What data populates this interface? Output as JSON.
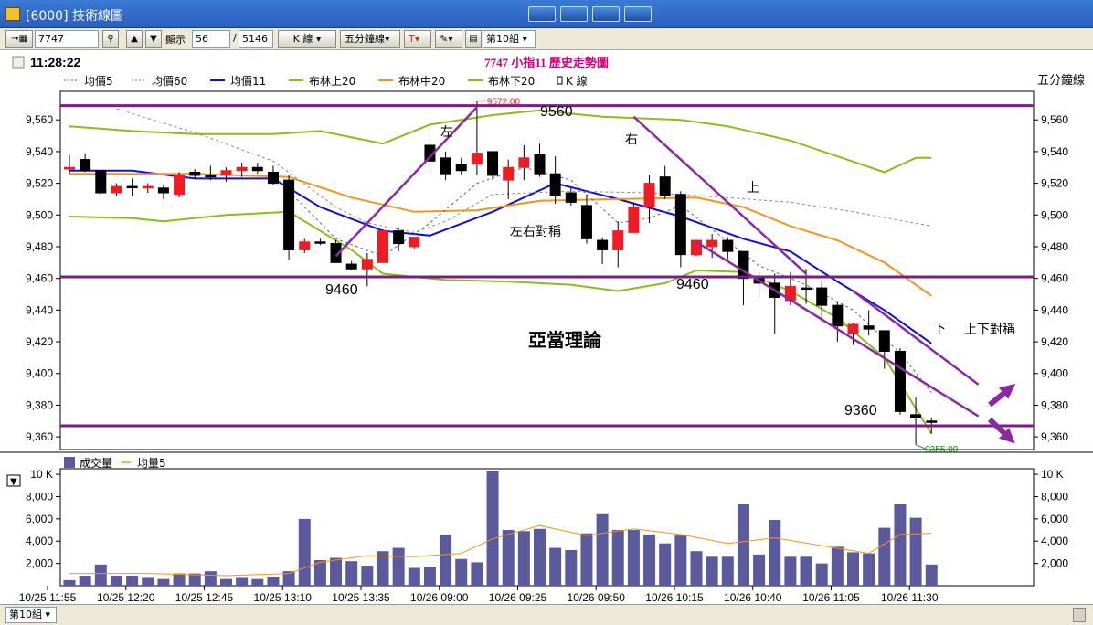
{
  "window": {
    "title": "[6000] 技術線圖"
  },
  "toolbar": {
    "symbol": "7747",
    "display_label": "顯示",
    "display_count": "56",
    "total_count": "5146",
    "chart_type": "K 線",
    "period": "五分鐘線",
    "text_tool": "T",
    "group": "第10組"
  },
  "header": {
    "time": "11:28:22",
    "chart_title": "7747 小指11  歷史走勢圖",
    "period_label": "五分鐘線"
  },
  "legend": [
    {
      "label": "均價5",
      "color": "#555555",
      "style": "dash"
    },
    {
      "label": "均價60",
      "color": "#777777",
      "style": "dash"
    },
    {
      "label": "均價11",
      "color": "#1010d0",
      "style": "solid"
    },
    {
      "label": "布林上20",
      "color": "#8cbc1c",
      "style": "solid"
    },
    {
      "label": "布林中20",
      "color": "#f0961e",
      "style": "solid"
    },
    {
      "label": "布林下20",
      "color": "#8cbc1c",
      "style": "solid"
    },
    {
      "label": "K 線",
      "color": "#000000",
      "style": "candle-icon"
    }
  ],
  "volume_legend": [
    {
      "label": "成交量",
      "color": "#5a5a9c"
    },
    {
      "label": "均量5",
      "color": "#f0961e"
    }
  ],
  "colors": {
    "up": "#ee1c24",
    "down": "#000000",
    "volume": "#5a5a9c",
    "level_line": "#7a1e84",
    "trend_line": "#8a2aa0",
    "annotation_text": "#c0007a"
  },
  "chart_data": {
    "type": "candlestick",
    "title": "7747 小指11  歷史走勢圖",
    "price_axis": {
      "ticks": [
        "9,360",
        "9,380",
        "9,400",
        "9,420",
        "9,440",
        "9,460",
        "9,480",
        "9,500",
        "9,520",
        "9,540",
        "9,560"
      ],
      "range": [
        9352,
        9578
      ]
    },
    "volume_axis": {
      "ticks": [
        "2,000",
        "4,000",
        "6,000",
        "8,000",
        "10 K"
      ],
      "range": [
        0,
        10500
      ]
    },
    "time_labels": [
      "10/25 11:55",
      "10/25 12:20",
      "10/25 12:45",
      "10/25 13:10",
      "10/25 13:35",
      "10/26 09:00",
      "10/26 09:25",
      "10/26 09:50",
      "10/26 10:15",
      "10/26 10:40",
      "10/26 11:05",
      "10/26 11:30"
    ],
    "candles": [
      {
        "o": 9529,
        "h": 9538,
        "l": 9526,
        "c": 9530
      },
      {
        "o": 9535,
        "h": 9539,
        "l": 9527,
        "c": 9528
      },
      {
        "o": 9528,
        "h": 9528,
        "l": 9513,
        "c": 9514
      },
      {
        "o": 9514,
        "h": 9520,
        "l": 9512,
        "c": 9518
      },
      {
        "o": 9518,
        "h": 9523,
        "l": 9512,
        "c": 9518
      },
      {
        "o": 9517,
        "h": 9520,
        "l": 9514,
        "c": 9518
      },
      {
        "o": 9517,
        "h": 9519,
        "l": 9510,
        "c": 9514
      },
      {
        "o": 9513,
        "h": 9527,
        "l": 9511,
        "c": 9525
      },
      {
        "o": 9527,
        "h": 9529,
        "l": 9523,
        "c": 9525
      },
      {
        "o": 9525,
        "h": 9531,
        "l": 9522,
        "c": 9524
      },
      {
        "o": 9525,
        "h": 9530,
        "l": 9521,
        "c": 9528
      },
      {
        "o": 9528,
        "h": 9533,
        "l": 9524,
        "c": 9530
      },
      {
        "o": 9530,
        "h": 9533,
        "l": 9526,
        "c": 9528
      },
      {
        "o": 9527,
        "h": 9531,
        "l": 9519,
        "c": 9520
      },
      {
        "o": 9522,
        "h": 9525,
        "l": 9472,
        "c": 9478
      },
      {
        "o": 9478,
        "h": 9485,
        "l": 9476,
        "c": 9483
      },
      {
        "o": 9483,
        "h": 9485,
        "l": 9481,
        "c": 9483
      },
      {
        "o": 9482,
        "h": 9484,
        "l": 9470,
        "c": 9470
      },
      {
        "o": 9469,
        "h": 9471,
        "l": 9465,
        "c": 9466
      },
      {
        "o": 9466,
        "h": 9476,
        "l": 9455,
        "c": 9472
      },
      {
        "o": 9470,
        "h": 9491,
        "l": 9470,
        "c": 9490
      },
      {
        "o": 9490,
        "h": 9492,
        "l": 9477,
        "c": 9482
      },
      {
        "o": 9480,
        "h": 9486,
        "l": 9479,
        "c": 9486
      },
      {
        "o": 9544,
        "h": 9553,
        "l": 9527,
        "c": 9534
      },
      {
        "o": 9536,
        "h": 9540,
        "l": 9522,
        "c": 9526
      },
      {
        "o": 9532,
        "h": 9536,
        "l": 9525,
        "c": 9528
      },
      {
        "o": 9532,
        "h": 9572,
        "l": 9525,
        "c": 9539
      },
      {
        "o": 9540,
        "h": 9540,
        "l": 9522,
        "c": 9525
      },
      {
        "o": 9522,
        "h": 9535,
        "l": 9510,
        "c": 9530
      },
      {
        "o": 9530,
        "h": 9544,
        "l": 9522,
        "c": 9536
      },
      {
        "o": 9538,
        "h": 9545,
        "l": 9524,
        "c": 9526
      },
      {
        "o": 9526,
        "h": 9537,
        "l": 9507,
        "c": 9512
      },
      {
        "o": 9514,
        "h": 9517,
        "l": 9506,
        "c": 9508
      },
      {
        "o": 9506,
        "h": 9513,
        "l": 9482,
        "c": 9485
      },
      {
        "o": 9484,
        "h": 9486,
        "l": 9469,
        "c": 9478
      },
      {
        "o": 9478,
        "h": 9496,
        "l": 9467,
        "c": 9490
      },
      {
        "o": 9489,
        "h": 9508,
        "l": 9489,
        "c": 9505
      },
      {
        "o": 9505,
        "h": 9525,
        "l": 9495,
        "c": 9520
      },
      {
        "o": 9524,
        "h": 9531,
        "l": 9510,
        "c": 9512
      },
      {
        "o": 9513,
        "h": 9515,
        "l": 9467,
        "c": 9475
      },
      {
        "o": 9475,
        "h": 9484,
        "l": 9474,
        "c": 9484
      },
      {
        "o": 9480,
        "h": 9488,
        "l": 9473,
        "c": 9484
      },
      {
        "o": 9484,
        "h": 9486,
        "l": 9472,
        "c": 9477
      },
      {
        "o": 9477,
        "h": 9477,
        "l": 9443,
        "c": 9460
      },
      {
        "o": 9460,
        "h": 9464,
        "l": 9448,
        "c": 9457
      },
      {
        "o": 9457,
        "h": 9463,
        "l": 9425,
        "c": 9448
      },
      {
        "o": 9446,
        "h": 9464,
        "l": 9443,
        "c": 9455
      },
      {
        "o": 9454,
        "h": 9466,
        "l": 9444,
        "c": 9454
      },
      {
        "o": 9454,
        "h": 9458,
        "l": 9433,
        "c": 9443
      },
      {
        "o": 9443,
        "h": 9445,
        "l": 9420,
        "c": 9430
      },
      {
        "o": 9425,
        "h": 9432,
        "l": 9418,
        "c": 9431
      },
      {
        "o": 9430,
        "h": 9440,
        "l": 9424,
        "c": 9428
      },
      {
        "o": 9427,
        "h": 9427,
        "l": 9403,
        "c": 9414
      },
      {
        "o": 9414,
        "h": 9416,
        "l": 9374,
        "c": 9376
      },
      {
        "o": 9374,
        "h": 9385,
        "l": 9355,
        "c": 9372
      },
      {
        "o": 9370,
        "h": 9372,
        "l": 9362,
        "c": 9370
      }
    ],
    "volumes": [
      500,
      900,
      1900,
      900,
      900,
      700,
      600,
      1100,
      1100,
      1300,
      600,
      700,
      600,
      800,
      1300,
      6000,
      2300,
      2500,
      2200,
      1800,
      3100,
      3400,
      1600,
      1700,
      4600,
      2400,
      2100,
      10300,
      5000,
      4900,
      5100,
      3400,
      3200,
      4700,
      6500,
      5000,
      5000,
      4600,
      3800,
      4500,
      3100,
      2600,
      2600,
      7300,
      2800,
      5900,
      2600,
      2600,
      2000,
      3500,
      3000,
      2900,
      5200,
      7300,
      6100,
      1900
    ],
    "series": [
      {
        "name": "均價11",
        "color": "#1010d0",
        "values": [
          {
            "i": 0,
            "v": 9528
          },
          {
            "i": 4,
            "v": 9528
          },
          {
            "i": 8,
            "v": 9523
          },
          {
            "i": 13,
            "v": 9523
          },
          {
            "i": 16,
            "v": 9505
          },
          {
            "i": 20,
            "v": 9490
          },
          {
            "i": 23,
            "v": 9487
          },
          {
            "i": 27,
            "v": 9502
          },
          {
            "i": 31,
            "v": 9520
          },
          {
            "i": 35,
            "v": 9510
          },
          {
            "i": 39,
            "v": 9499
          },
          {
            "i": 43,
            "v": 9485
          },
          {
            "i": 46,
            "v": 9477
          },
          {
            "i": 49,
            "v": 9458
          },
          {
            "i": 52,
            "v": 9440
          },
          {
            "i": 55,
            "v": 9419
          }
        ]
      },
      {
        "name": "布林上20",
        "color": "#8cbc1c",
        "values": [
          {
            "i": 0,
            "v": 9556
          },
          {
            "i": 4,
            "v": 9553
          },
          {
            "i": 8,
            "v": 9551
          },
          {
            "i": 13,
            "v": 9551
          },
          {
            "i": 16,
            "v": 9553
          },
          {
            "i": 20,
            "v": 9545
          },
          {
            "i": 23,
            "v": 9557
          },
          {
            "i": 27,
            "v": 9563
          },
          {
            "i": 30,
            "v": 9566
          },
          {
            "i": 34,
            "v": 9562
          },
          {
            "i": 39,
            "v": 9560
          },
          {
            "i": 42,
            "v": 9556
          },
          {
            "i": 46,
            "v": 9547
          },
          {
            "i": 49,
            "v": 9537
          },
          {
            "i": 52,
            "v": 9527
          },
          {
            "i": 54,
            "v": 9536
          },
          {
            "i": 55,
            "v": 9536
          }
        ]
      },
      {
        "name": "布林中20",
        "color": "#f0961e",
        "values": [
          {
            "i": 0,
            "v": 9526
          },
          {
            "i": 8,
            "v": 9526
          },
          {
            "i": 14,
            "v": 9524
          },
          {
            "i": 18,
            "v": 9511
          },
          {
            "i": 22,
            "v": 9502
          },
          {
            "i": 26,
            "v": 9503
          },
          {
            "i": 30,
            "v": 9509
          },
          {
            "i": 35,
            "v": 9510
          },
          {
            "i": 40,
            "v": 9511
          },
          {
            "i": 43,
            "v": 9505
          },
          {
            "i": 46,
            "v": 9493
          },
          {
            "i": 49,
            "v": 9484
          },
          {
            "i": 52,
            "v": 9470
          },
          {
            "i": 55,
            "v": 9449
          }
        ]
      },
      {
        "name": "布林下20",
        "color": "#8cbc1c",
        "values": [
          {
            "i": 0,
            "v": 9499
          },
          {
            "i": 4,
            "v": 9498
          },
          {
            "i": 6,
            "v": 9496
          },
          {
            "i": 10,
            "v": 9500
          },
          {
            "i": 14,
            "v": 9502
          },
          {
            "i": 18,
            "v": 9478
          },
          {
            "i": 20,
            "v": 9463
          },
          {
            "i": 24,
            "v": 9459
          },
          {
            "i": 28,
            "v": 9458
          },
          {
            "i": 32,
            "v": 9456
          },
          {
            "i": 35,
            "v": 9452
          },
          {
            "i": 38,
            "v": 9457
          },
          {
            "i": 40,
            "v": 9465
          },
          {
            "i": 43,
            "v": 9464
          },
          {
            "i": 46,
            "v": 9452
          },
          {
            "i": 49,
            "v": 9435
          },
          {
            "i": 52,
            "v": 9410
          },
          {
            "i": 55,
            "v": 9362
          }
        ]
      },
      {
        "name": "均價60",
        "color": "#888888",
        "values": [
          {
            "i": 3,
            "v": 9567
          },
          {
            "i": 8,
            "v": 9552
          },
          {
            "i": 13,
            "v": 9534
          },
          {
            "i": 17,
            "v": 9505
          },
          {
            "i": 19,
            "v": 9495
          },
          {
            "i": 22,
            "v": 9489
          },
          {
            "i": 24,
            "v": 9496
          },
          {
            "i": 27,
            "v": 9513
          },
          {
            "i": 32,
            "v": 9515
          },
          {
            "i": 37,
            "v": 9514
          },
          {
            "i": 42,
            "v": 9511
          },
          {
            "i": 46,
            "v": 9508
          },
          {
            "i": 50,
            "v": 9502
          },
          {
            "i": 55,
            "v": 9493
          }
        ]
      },
      {
        "name": "均價5",
        "color": "#666666",
        "values": [
          {
            "i": 14,
            "v": 9515
          },
          {
            "i": 17,
            "v": 9485
          },
          {
            "i": 20,
            "v": 9474
          },
          {
            "i": 23,
            "v": 9495
          },
          {
            "i": 26,
            "v": 9520
          },
          {
            "i": 29,
            "v": 9530
          },
          {
            "i": 32,
            "v": 9522
          },
          {
            "i": 35,
            "v": 9495
          },
          {
            "i": 37,
            "v": 9498
          },
          {
            "i": 39,
            "v": 9506
          },
          {
            "i": 41,
            "v": 9491
          },
          {
            "i": 44,
            "v": 9468
          },
          {
            "i": 47,
            "v": 9456
          },
          {
            "i": 50,
            "v": 9440
          },
          {
            "i": 53,
            "v": 9413
          },
          {
            "i": 55,
            "v": 9388
          }
        ]
      }
    ],
    "volume_ma": [
      {
        "i": 0,
        "v": 1100
      },
      {
        "i": 5,
        "v": 1100
      },
      {
        "i": 10,
        "v": 900
      },
      {
        "i": 14,
        "v": 1100
      },
      {
        "i": 16,
        "v": 2100
      },
      {
        "i": 19,
        "v": 2700
      },
      {
        "i": 22,
        "v": 2600
      },
      {
        "i": 25,
        "v": 2900
      },
      {
        "i": 27,
        "v": 4200
      },
      {
        "i": 30,
        "v": 5400
      },
      {
        "i": 33,
        "v": 4500
      },
      {
        "i": 36,
        "v": 5100
      },
      {
        "i": 39,
        "v": 4600
      },
      {
        "i": 42,
        "v": 3800
      },
      {
        "i": 45,
        "v": 4300
      },
      {
        "i": 48,
        "v": 3600
      },
      {
        "i": 51,
        "v": 2900
      },
      {
        "i": 53,
        "v": 4600
      },
      {
        "i": 55,
        "v": 4700
      }
    ],
    "annotations": {
      "high_label": "9572.00",
      "low_label": "9355.00",
      "level_labels": [
        "9560",
        "9460",
        "9460",
        "9360"
      ],
      "text_labels": [
        "左",
        "右",
        "上",
        "下",
        "左右對稱",
        "上下對稱",
        "亞當理論"
      ]
    },
    "level_lines": [
      9569,
      9461,
      9367
    ]
  }
}
